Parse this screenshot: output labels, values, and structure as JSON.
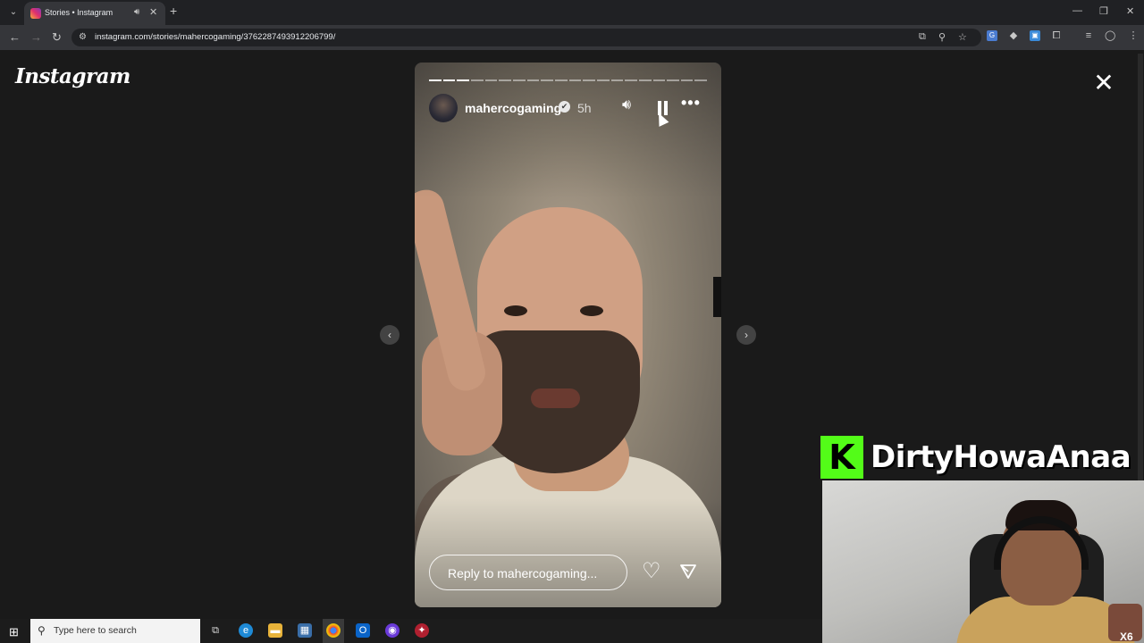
{
  "browser": {
    "tab": {
      "title": "Stories • Instagram"
    },
    "address": {
      "url": "instagram.com/stories/mahercogaming/3762287493912206799/"
    }
  },
  "page": {
    "logo": "Instagram",
    "close_label": "✕",
    "story": {
      "progress": {
        "segments_total": 20,
        "segments_done": 3
      },
      "username": "mahercogaming",
      "verified_mark": "✔",
      "time_ago": "5h",
      "reply_placeholder": "Reply to mahercogaming..."
    }
  },
  "stream_overlay": {
    "platform_logo": "K",
    "streamer_name": "DirtyHowaAnaa",
    "badge": "X6"
  },
  "taskbar": {
    "search_placeholder": "Type here to search"
  },
  "colors": {
    "kick_green": "#53fc18",
    "page_bg": "#1a1a1a",
    "chrome_bg": "#202124"
  },
  "icons": [
    "search-icon",
    "back-icon",
    "forward-icon",
    "reload-icon",
    "speaker-icon",
    "pause-icon",
    "more-icon",
    "heart-icon",
    "share-icon",
    "close-icon",
    "chevron-left-icon",
    "chevron-right-icon"
  ]
}
